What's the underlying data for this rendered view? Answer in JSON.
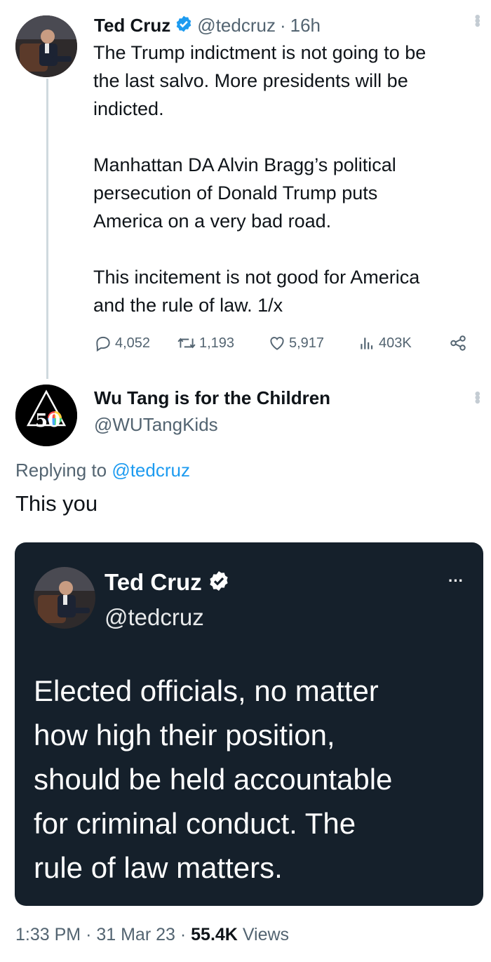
{
  "tweet": {
    "name": "Ted Cruz",
    "handle": "@tedcruz",
    "separator": "·",
    "time": "16h",
    "text": "The Trump indictment is not going to be\nthe last salvo. More presidents will be\nindicted.\n\nManhattan DA Alvin Bragg’s political\npersecution of Donald Trump puts\nAmerica on a very bad road.\n\nThis incitement is not good for America\nand the rule of law. 1/x",
    "replies": "4,052",
    "retweets": "1,193",
    "likes": "5,917",
    "views": "403K"
  },
  "reply": {
    "name": "Wu Tang is for the Children",
    "handle": "@WUTangKids",
    "avatar_text": "50",
    "replying_prefix": "Replying to",
    "replying_handle": "@tedcruz",
    "text": "This you",
    "embedded": {
      "name": "Ted Cruz",
      "handle": "@tedcruz",
      "more": "···",
      "text": "Elected officials, no matter\nhow high their position,\nshould be held accountable\nfor criminal conduct. The\nrule of law matters."
    },
    "footer": {
      "time": "1:33 PM",
      "separator": "·",
      "date": "31 Mar 23",
      "views_count": "55.4K",
      "views_label": "Views"
    }
  },
  "colors": {
    "link": "#1d9bf0",
    "verified": "#1d9bf0",
    "embed_bg": "#15202b",
    "secondary_text": "#536471"
  }
}
